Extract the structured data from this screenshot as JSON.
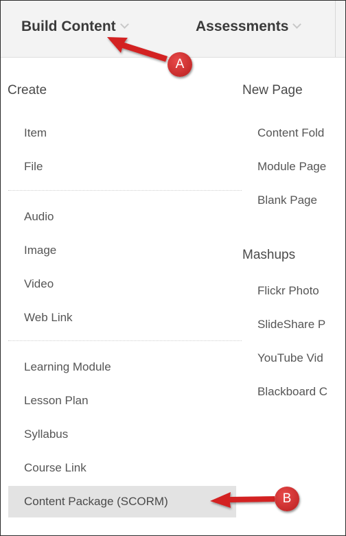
{
  "tabs": [
    {
      "label": "Build Content"
    },
    {
      "label": "Assessments"
    }
  ],
  "menu": {
    "create": {
      "heading": "Create",
      "items": [
        "Item",
        "File",
        "Audio",
        "Image",
        "Video",
        "Web Link",
        "Learning Module",
        "Lesson Plan",
        "Syllabus",
        "Course Link",
        "Content Package (SCORM)"
      ]
    },
    "new_page": {
      "heading": "New Page",
      "items": [
        "Content Fold",
        "Module Page",
        "Blank Page"
      ]
    },
    "mashups": {
      "heading": "Mashups",
      "items": [
        "Flickr Photo",
        "SlideShare P",
        "YouTube Vid",
        "Blackboard C"
      ]
    }
  },
  "selected_item": "Content Package (SCORM)",
  "callouts": {
    "a": "A",
    "b": "B"
  },
  "colors": {
    "accent_red": "#d32020",
    "highlight": "#e3e3e3",
    "topbar": "#f3f3f3"
  },
  "icons": {
    "dropdown": "chevron-down-icon"
  }
}
